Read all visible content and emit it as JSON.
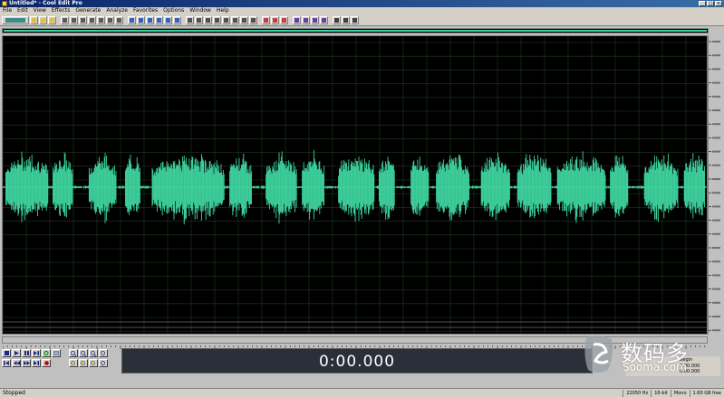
{
  "window": {
    "title": "Untitled* - Cool Edit Pro"
  },
  "menu": [
    "File",
    "Edit",
    "View",
    "Effects",
    "Generate",
    "Analyze",
    "Favorites",
    "Options",
    "Window",
    "Help"
  ],
  "transport": {
    "time": "0:00.000"
  },
  "status": {
    "state": "Stopped",
    "cells": [
      "22050 Hz",
      "16-bit",
      "Mono",
      "1.60 GB free"
    ]
  },
  "selection_view": {
    "begin_label": "Begin",
    "end_label": "End",
    "length_label": "Length",
    "sel_begin": "0:00.000",
    "view_begin": "0:00.000"
  },
  "watermark": {
    "chinese": "数码多",
    "url": "Sooma.com"
  },
  "colors": {
    "waveform": "#3fd4a0",
    "grid": "#1e3a1e",
    "background": "#000000"
  },
  "icons": {
    "play": "play-icon",
    "stop": "stop-icon",
    "pause": "pause-icon",
    "record": "record-icon",
    "loop": "loop-icon"
  }
}
